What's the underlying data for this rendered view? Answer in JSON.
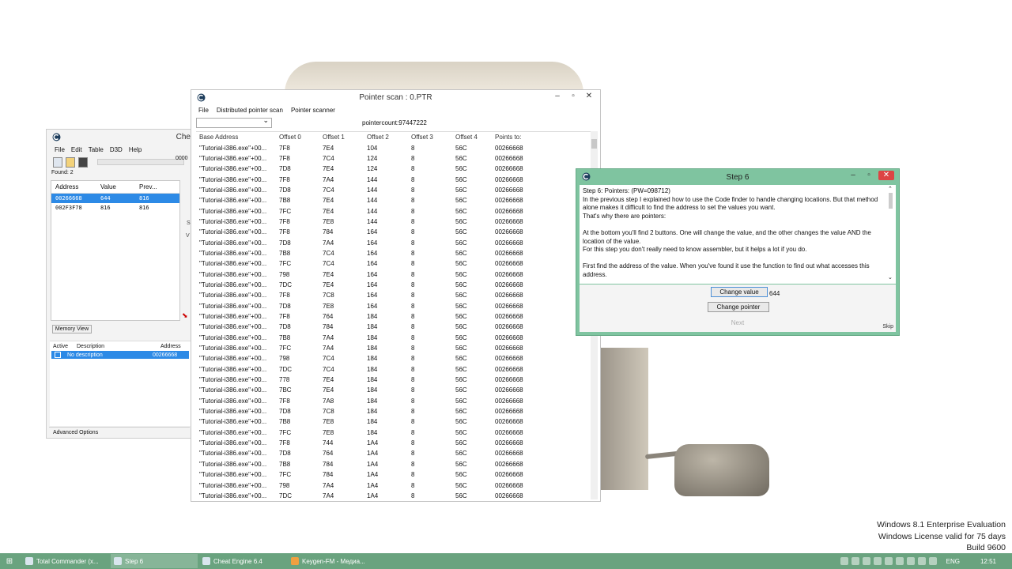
{
  "desktop": {
    "watermark": [
      "Windows 8.1 Enterprise Evaluation",
      "Windows License valid for 75 days",
      "Build 9600"
    ]
  },
  "ce_main": {
    "title": "Che",
    "menu": [
      "File",
      "Edit",
      "Table",
      "D3D",
      "Help"
    ],
    "found": "Found: 2",
    "cut_value": "0000",
    "columns": [
      "Address",
      "Value",
      "Prev..."
    ],
    "rows": [
      [
        "00266668",
        "644",
        "816"
      ],
      [
        "002F3F78",
        "816",
        "816"
      ]
    ],
    "memory_view": "Memory View",
    "table_columns": [
      "Active",
      "Description",
      "Address"
    ],
    "table_row": {
      "description": "No description",
      "address": "00266668"
    },
    "advanced_options": "Advanced Options",
    "side_s": "S",
    "side_v": "V"
  },
  "pointer_scan": {
    "title": "Pointer scan : 0.PTR",
    "menu": [
      "File",
      "Distributed pointer scan",
      "Pointer scanner"
    ],
    "pointercount": "pointercount:97447222",
    "columns": [
      "Base Address",
      "Offset 0",
      "Offset 1",
      "Offset 2",
      "Offset 3",
      "Offset 4",
      "Points to:"
    ],
    "base": "\"Tutorial-i386.exe\"+00...",
    "rows": [
      [
        "7F8",
        "7E4",
        "104",
        "8",
        "56C",
        "00266668"
      ],
      [
        "7F8",
        "7C4",
        "124",
        "8",
        "56C",
        "00266668"
      ],
      [
        "7D8",
        "7E4",
        "124",
        "8",
        "56C",
        "00266668"
      ],
      [
        "7F8",
        "7A4",
        "144",
        "8",
        "56C",
        "00266668"
      ],
      [
        "7D8",
        "7C4",
        "144",
        "8",
        "56C",
        "00266668"
      ],
      [
        "7B8",
        "7E4",
        "144",
        "8",
        "56C",
        "00266668"
      ],
      [
        "7FC",
        "7E4",
        "144",
        "8",
        "56C",
        "00266668"
      ],
      [
        "7F8",
        "7E8",
        "144",
        "8",
        "56C",
        "00266668"
      ],
      [
        "7F8",
        "784",
        "164",
        "8",
        "56C",
        "00266668"
      ],
      [
        "7D8",
        "7A4",
        "164",
        "8",
        "56C",
        "00266668"
      ],
      [
        "7B8",
        "7C4",
        "164",
        "8",
        "56C",
        "00266668"
      ],
      [
        "7FC",
        "7C4",
        "164",
        "8",
        "56C",
        "00266668"
      ],
      [
        "798",
        "7E4",
        "164",
        "8",
        "56C",
        "00266668"
      ],
      [
        "7DC",
        "7E4",
        "164",
        "8",
        "56C",
        "00266668"
      ],
      [
        "7F8",
        "7C8",
        "164",
        "8",
        "56C",
        "00266668"
      ],
      [
        "7D8",
        "7E8",
        "164",
        "8",
        "56C",
        "00266668"
      ],
      [
        "7F8",
        "764",
        "184",
        "8",
        "56C",
        "00266668"
      ],
      [
        "7D8",
        "784",
        "184",
        "8",
        "56C",
        "00266668"
      ],
      [
        "7B8",
        "7A4",
        "184",
        "8",
        "56C",
        "00266668"
      ],
      [
        "7FC",
        "7A4",
        "184",
        "8",
        "56C",
        "00266668"
      ],
      [
        "798",
        "7C4",
        "184",
        "8",
        "56C",
        "00266668"
      ],
      [
        "7DC",
        "7C4",
        "184",
        "8",
        "56C",
        "00266668"
      ],
      [
        "778",
        "7E4",
        "184",
        "8",
        "56C",
        "00266668"
      ],
      [
        "7BC",
        "7E4",
        "184",
        "8",
        "56C",
        "00266668"
      ],
      [
        "7F8",
        "7A8",
        "184",
        "8",
        "56C",
        "00266668"
      ],
      [
        "7D8",
        "7C8",
        "184",
        "8",
        "56C",
        "00266668"
      ],
      [
        "7B8",
        "7E8",
        "184",
        "8",
        "56C",
        "00266668"
      ],
      [
        "7FC",
        "7E8",
        "184",
        "8",
        "56C",
        "00266668"
      ],
      [
        "7F8",
        "744",
        "1A4",
        "8",
        "56C",
        "00266668"
      ],
      [
        "7D8",
        "764",
        "1A4",
        "8",
        "56C",
        "00266668"
      ],
      [
        "7B8",
        "784",
        "1A4",
        "8",
        "56C",
        "00266668"
      ],
      [
        "7FC",
        "784",
        "1A4",
        "8",
        "56C",
        "00266668"
      ],
      [
        "798",
        "7A4",
        "1A4",
        "8",
        "56C",
        "00266668"
      ],
      [
        "7DC",
        "7A4",
        "1A4",
        "8",
        "56C",
        "00266668"
      ]
    ]
  },
  "step6": {
    "title": "Step 6",
    "paragraphs": [
      "Step 6: Pointers: (PW=098712)\nIn the previous step I explained how to use the Code finder to handle changing locations. But that method alone makes it difficult to find the address to set the values you want.\nThat's why there are pointers:",
      "At the bottom you'll find 2 buttons. One will change the value, and the other changes the value AND the location of the value.\nFor this step you don't really need to know assembler, but it helps a lot if you do.",
      "First find the address of the value. When you've found it use the function to find out what accesses this address."
    ],
    "change_value": "Change value",
    "value": "644",
    "change_pointer": "Change pointer",
    "next": "Next",
    "skip": "Skip"
  },
  "taskbar": {
    "tasks": [
      "Total Commander (x...",
      "Step 6",
      "Cheat Engine 6.4",
      "Keygen-FM - Медиа..."
    ],
    "lang": "ENG",
    "time": "12:51"
  }
}
